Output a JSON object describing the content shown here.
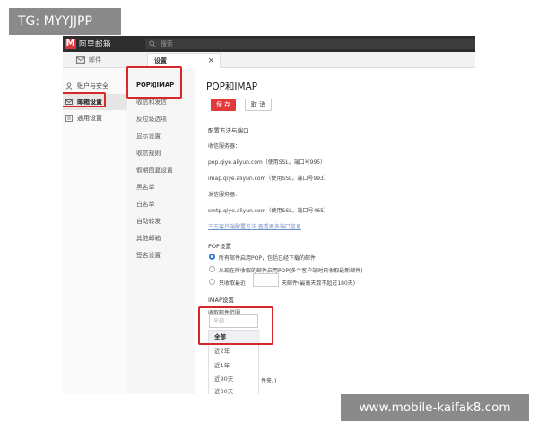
{
  "watermarks": {
    "top_left": "TG: MYYJJPP",
    "bottom_right": "www.mobile-kaifak8.com"
  },
  "app": {
    "logo_mark": "M",
    "logo_text": "阿里邮箱",
    "search_placeholder": "搜索",
    "tabs": {
      "mail": "邮件",
      "settings": "设置",
      "close": "×"
    }
  },
  "sidebar": {
    "items": [
      {
        "label": "账户与安全",
        "icon": "user-icon"
      },
      {
        "label": "邮箱设置",
        "icon": "mailbox-icon",
        "active": true
      },
      {
        "label": "通用设置",
        "icon": "general-settings-icon"
      }
    ]
  },
  "submenu": {
    "items": [
      {
        "label": "POP和IMAP",
        "active": true
      },
      {
        "label": "收信和发信"
      },
      {
        "label": "反垃圾选项"
      },
      {
        "label": "显示设置"
      },
      {
        "label": "收信规则"
      },
      {
        "label": "假期回复设置"
      },
      {
        "label": "黑名单"
      },
      {
        "label": "白名单"
      },
      {
        "label": "自动转发"
      },
      {
        "label": "其他邮箱"
      },
      {
        "label": "签名设置"
      }
    ]
  },
  "main": {
    "title": "POP和IMAP",
    "save_label": "保 存",
    "cancel_label": "取 消",
    "config_heading": "配置方法与端口",
    "receive_server_label": "收信服务器：",
    "pop_server": "pop.qiye.aliyun.com（使用SSL，端口号995）",
    "imap_server": "imap.qiye.aliyun.com（使用SSL，端口号993）",
    "send_server_label": "发信服务器：",
    "smtp_server": "smtp.qiye.aliyun.com（使用SSL，端口号465）",
    "help_links": "三方客户端配置方法  查看更多端口信息",
    "pop_heading": "POP设置",
    "pop_options": [
      {
        "label": "所有邮件启用POP，包括已经下载的邮件",
        "checked": true
      },
      {
        "label": "从现在所收取的邮件启用POP(多个客户端时只收取最新邮件)",
        "checked": false
      },
      {
        "label_before": "只收取最近",
        "label_after": "天邮件(最高天数不超过180天)",
        "checked": false
      }
    ],
    "imap_heading": "IMAP设置",
    "receive_range_label": "收取邮件范围",
    "select_placeholder": "全部",
    "dropdown_options": [
      {
        "label": "全部",
        "selected": true
      },
      {
        "label": "近2年"
      },
      {
        "label": "近1年"
      },
      {
        "label": "近90天"
      },
      {
        "label": "近30天"
      }
    ],
    "footer_fragment": "件夹。)"
  },
  "colors": {
    "accent_red": "#e23a3a",
    "highlight_red": "#d8262b",
    "radio_blue": "#2a74d5",
    "link_blue": "#6f8fc8",
    "topbar": "#2d2d2d"
  }
}
